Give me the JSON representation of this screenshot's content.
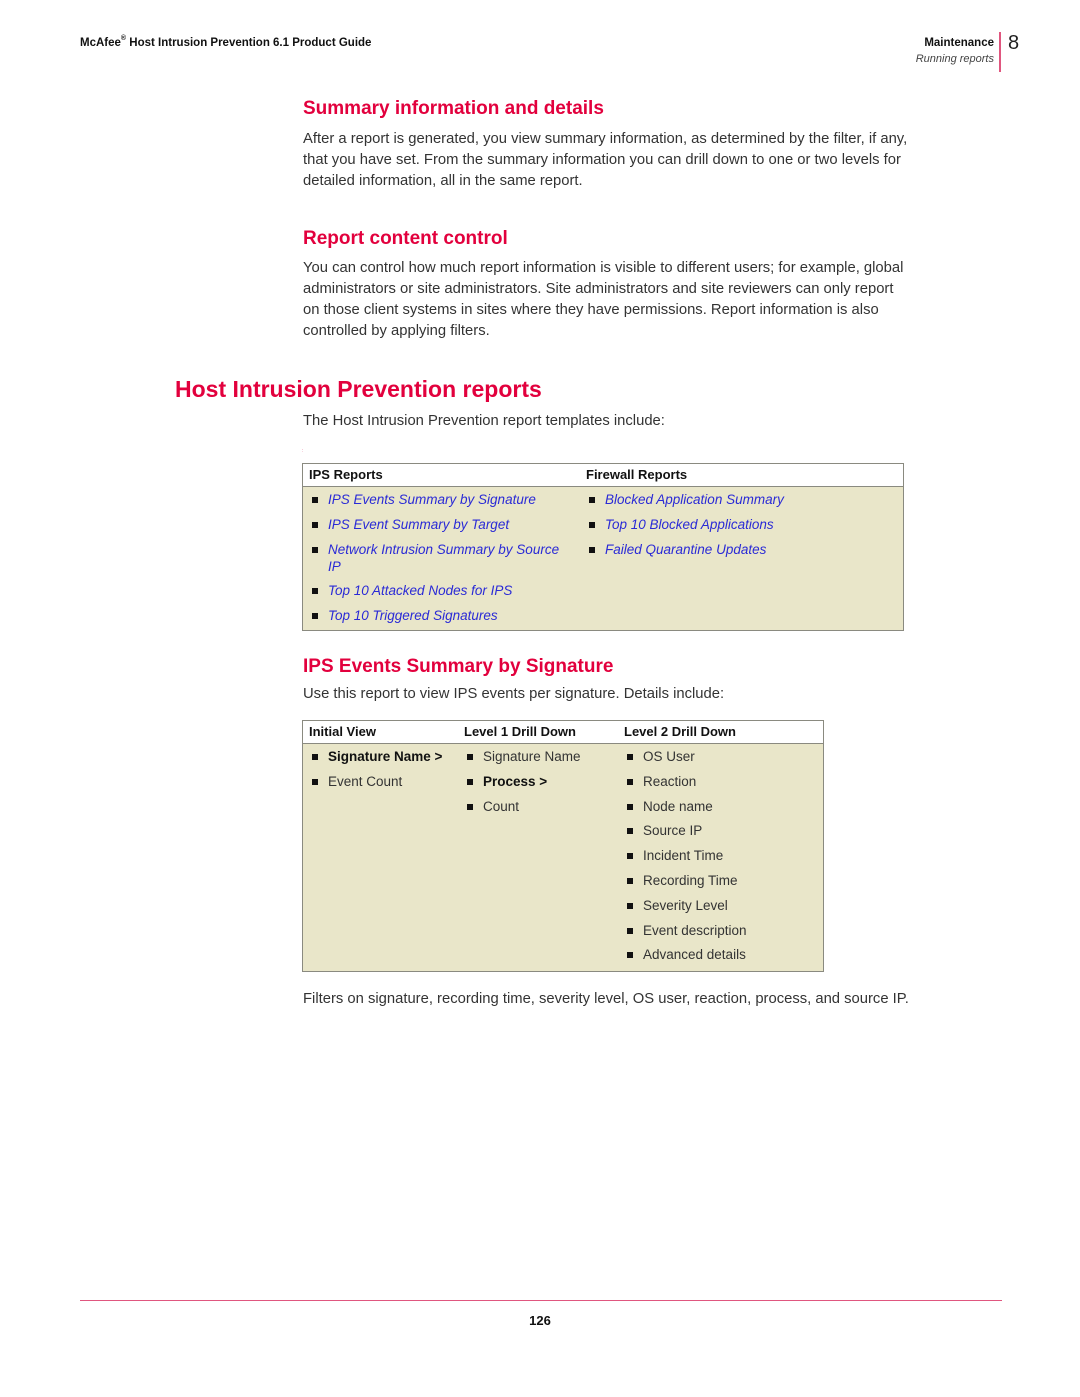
{
  "header": {
    "brand": "McAfee",
    "brand_mark": "®",
    "title": " Host Intrusion Prevention 6.1 Product Guide",
    "section": "Maintenance",
    "subsection": "Running reports",
    "chapter": "8"
  },
  "summary_section": {
    "heading": "Summary information and details",
    "body": "After a report is generated, you view summary information, as determined by the filter, if any, that you have set. From the summary information you can drill down to one or two levels for detailed information, all in the same report."
  },
  "content_control_section": {
    "heading": "Report content control",
    "body": "You can control how much report information is visible to different users; for example, global administrators or site administrators. Site administrators and site reviewers can only report on those client systems in sites where they have permissions. Report information is also controlled by applying filters."
  },
  "hip_reports": {
    "heading": "Host Intrusion Prevention reports",
    "intro": "The Host Intrusion Prevention report templates include:",
    "table": {
      "columns": [
        "IPS Reports",
        "Firewall Reports"
      ],
      "ips_reports": [
        "IPS Events Summary by Signature",
        "IPS Event Summary by Target",
        "Network Intrusion Summary by Source IP",
        "Top 10 Attacked Nodes for IPS",
        "Top 10 Triggered Signatures"
      ],
      "firewall_reports": [
        "Blocked Application Summary",
        "Top 10 Blocked Applications",
        "Failed Quarantine Updates"
      ]
    }
  },
  "ips_events_section": {
    "heading": "IPS Events Summary by Signature",
    "intro": "Use this report to view IPS events per signature. Details include:",
    "table": {
      "columns": [
        "Initial View",
        "Level 1 Drill Down",
        "Level 2 Drill Down"
      ],
      "initial_view": [
        "Signature Name >",
        "Event Count"
      ],
      "level1": [
        "Signature Name",
        "Process >",
        "Count"
      ],
      "level2": [
        "OS User",
        "Reaction",
        "Node name",
        "Source IP",
        "Incident Time",
        "Recording Time",
        "Severity Level",
        "Event description",
        "Advanced details"
      ]
    },
    "footer_text": "Filters on signature, recording time, severity level, OS user, reaction, process, and source IP."
  },
  "footer": {
    "page_number": "126"
  },
  "colors": {
    "heading": "#e2003d",
    "accent_rule": "#e0567f",
    "link": "#2a2ad6",
    "table_fill": "#e9e6c9"
  }
}
